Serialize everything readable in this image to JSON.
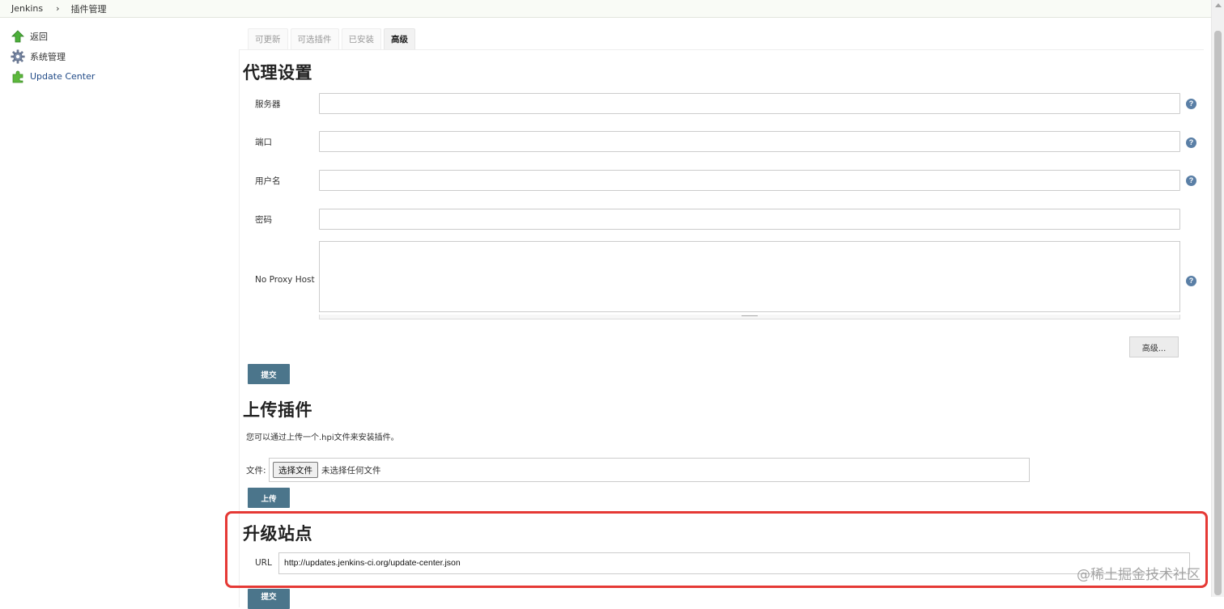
{
  "breadcrumb": {
    "root": "Jenkins",
    "separator": "›",
    "current": "插件管理"
  },
  "sidebar": {
    "items": [
      {
        "label": "返回",
        "icon": "up-arrow-icon"
      },
      {
        "label": "系统管理",
        "icon": "gear-icon"
      },
      {
        "label": "Update Center",
        "icon": "puzzle-icon"
      }
    ]
  },
  "tabs": [
    {
      "label": "可更新",
      "active": false
    },
    {
      "label": "可选插件",
      "active": false
    },
    {
      "label": "已安装",
      "active": false
    },
    {
      "label": "高级",
      "active": true
    }
  ],
  "proxy": {
    "title": "代理设置",
    "server_label": "服务器",
    "server_value": "",
    "port_label": "端口",
    "port_value": "",
    "username_label": "用户名",
    "username_value": "",
    "password_label": "密码",
    "password_value": "",
    "noproxy_label": "No Proxy Host",
    "noproxy_value": "",
    "help_glyph": "?",
    "advanced_button": "高级...",
    "submit_button": "提交"
  },
  "upload": {
    "title": "上传插件",
    "description": "您可以通过上传一个.hpi文件来安装插件。",
    "file_label": "文件:",
    "choose_file_button": "选择文件",
    "no_file_text": "未选择任何文件",
    "upload_button": "上传"
  },
  "site": {
    "title": "升级站点",
    "url_label": "URL",
    "url_value": "http://updates.jenkins-ci.org/update-center.json",
    "submit_button": "提交"
  },
  "watermark": "@稀土掘金技术社区",
  "colors": {
    "accent_button": "#4b758b",
    "highlight_border": "#e53935",
    "link": "#204a87",
    "help_icon": "#5a7fa6"
  }
}
